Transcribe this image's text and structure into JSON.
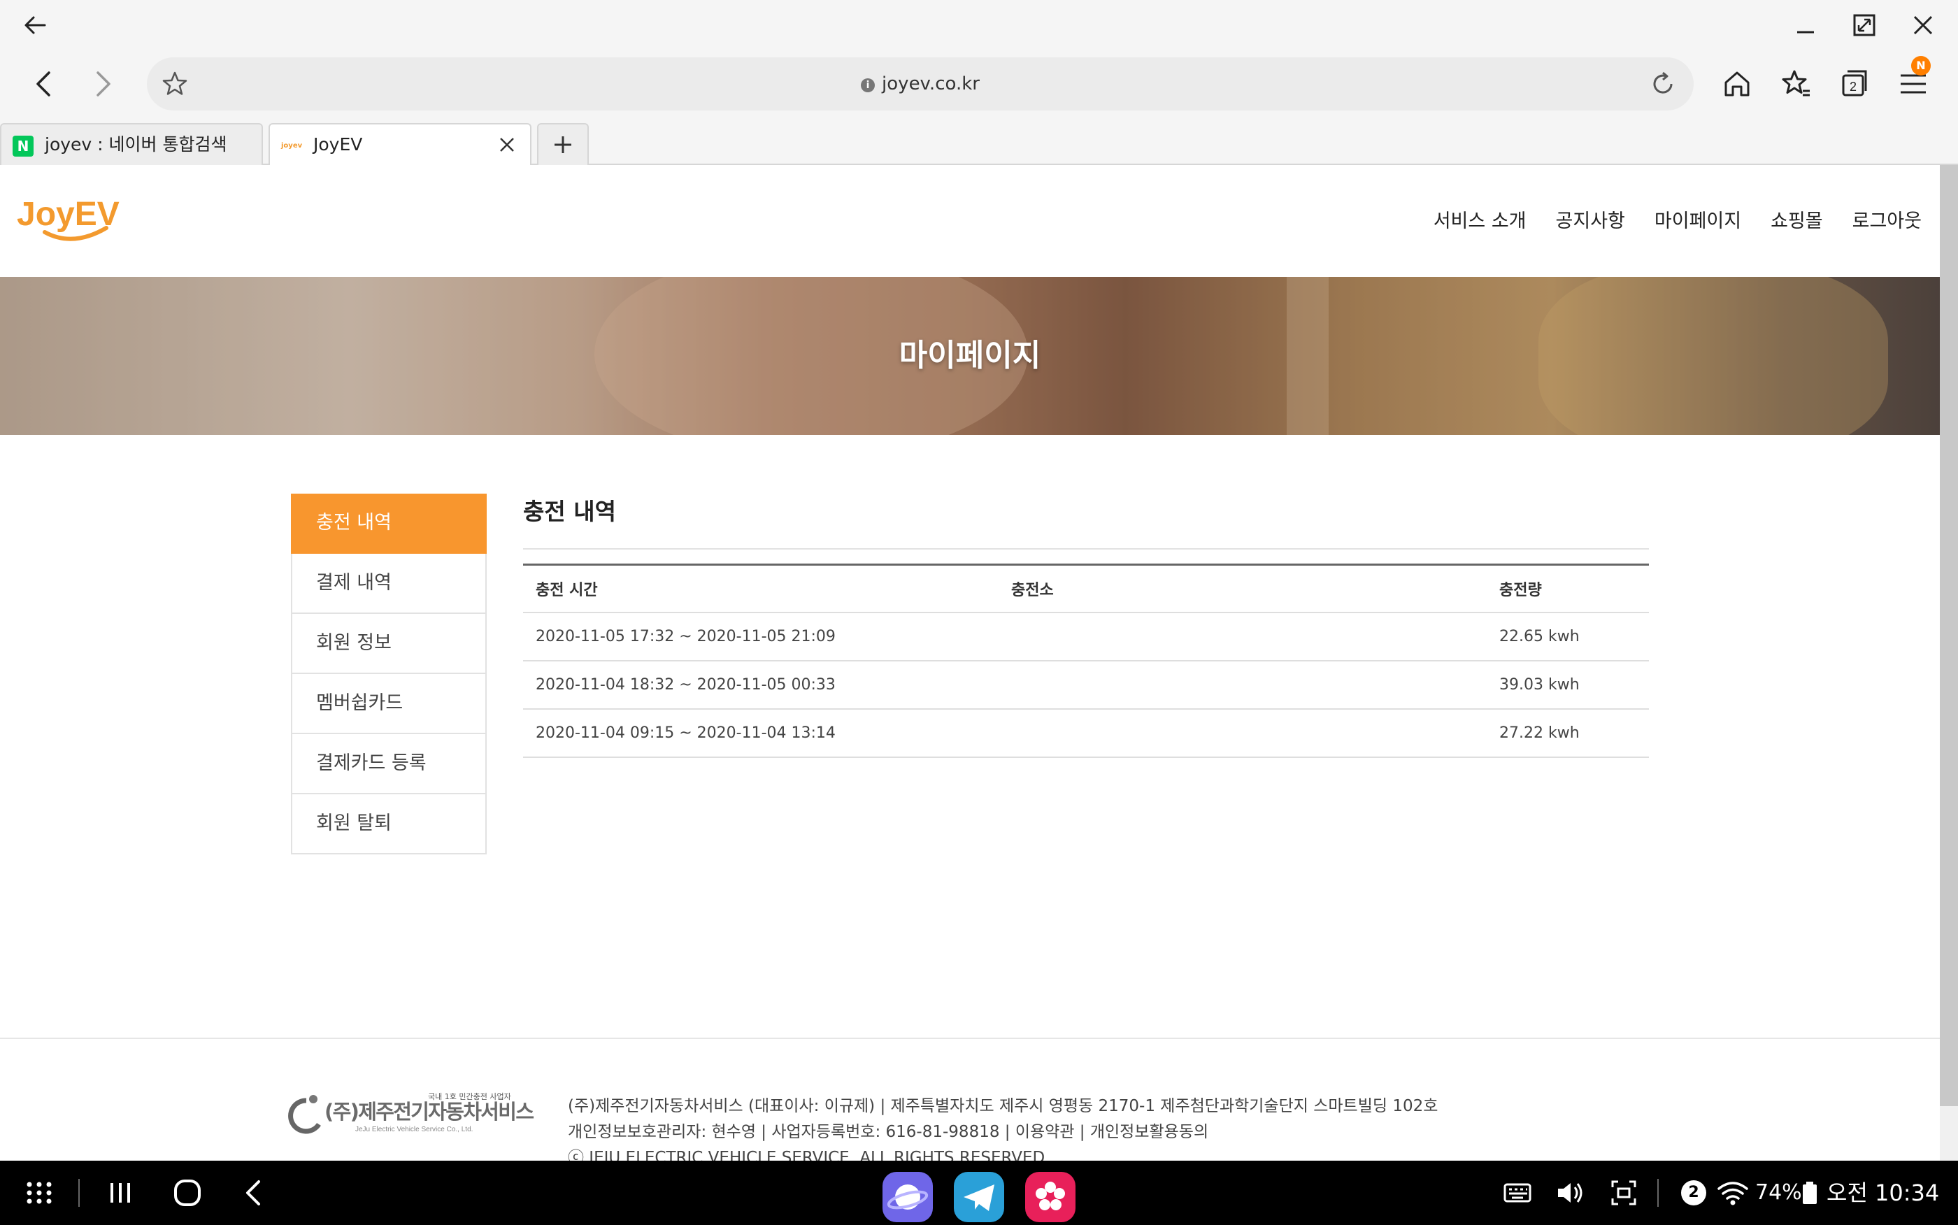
{
  "browser": {
    "url": "joyev.co.kr",
    "tabs": [
      {
        "label": "joyev : 네이버 통합검색",
        "favicon": "N"
      },
      {
        "label": "JoyEV",
        "favicon": "joyev"
      }
    ],
    "tab_count": "2",
    "notification_badge": "N",
    "accent_color": "#ff7f00"
  },
  "site": {
    "logo_text": "JoyEV",
    "nav": [
      "서비스 소개",
      "공지사항",
      "마이페이지",
      "쇼핑몰",
      "로그아웃"
    ],
    "hero_title": "마이페이지",
    "brand_color": "#f8962e"
  },
  "sidemenu": {
    "items": [
      "충전 내역",
      "결제 내역",
      "회원 정보",
      "멤버쉽카드",
      "결제카드 등록",
      "회원 탈퇴"
    ],
    "active_index": 0
  },
  "content": {
    "title": "충전 내역",
    "columns": [
      "충전 시간",
      "충전소",
      "충전량"
    ],
    "rows": [
      {
        "time": "2020-11-05 17:32 ~ 2020-11-05 21:09",
        "station": "",
        "amount": "22.65 kwh"
      },
      {
        "time": "2020-11-04 18:32 ~ 2020-11-05 00:33",
        "station": "",
        "amount": "39.03 kwh"
      },
      {
        "time": "2020-11-04 09:15 ~ 2020-11-04 13:14",
        "station": "",
        "amount": "27.22 kwh"
      }
    ]
  },
  "footer": {
    "logo_small": "국내 1호 민간충전 사업자",
    "logo_main": "(주)제주전기자동차서비스",
    "logo_sub": "JeJu Electric Vehicle Service Co., Ltd.",
    "line1": "(주)제주전기자동차서비스 (대표이사: 이규제) | 제주특별자치도 제주시 영평동 2170-1 제주첨단과학기술단지 스마트빌딩 102호",
    "line2": "개인정보보호관리자: 현수영 | 사업자등록번호: 616-81-98818 | 이용약관 | 개인정보활용동의",
    "line3": "ⓒ JEJU ELECTRIC VEHICLE SERVICE. ALL RIGHTS RESERVED."
  },
  "system": {
    "notification_count": "2",
    "battery": "74%",
    "time": "오전 10:34",
    "icons": [
      "apps-grid-icon",
      "recents-icon",
      "home-icon",
      "back-icon",
      "keyboard-icon",
      "volume-icon",
      "screenshot-icon",
      "wifi-icon",
      "battery-icon"
    ]
  }
}
